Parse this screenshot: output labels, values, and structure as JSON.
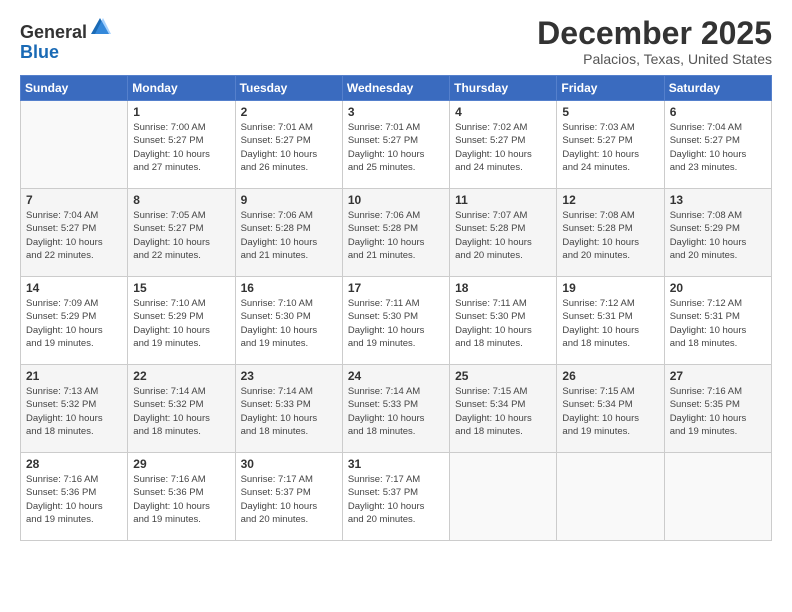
{
  "logo": {
    "general": "General",
    "blue": "Blue"
  },
  "header": {
    "month": "December 2025",
    "location": "Palacios, Texas, United States"
  },
  "days_of_week": [
    "Sunday",
    "Monday",
    "Tuesday",
    "Wednesday",
    "Thursday",
    "Friday",
    "Saturday"
  ],
  "weeks": [
    [
      {
        "num": "",
        "info": ""
      },
      {
        "num": "1",
        "info": "Sunrise: 7:00 AM\nSunset: 5:27 PM\nDaylight: 10 hours\nand 27 minutes."
      },
      {
        "num": "2",
        "info": "Sunrise: 7:01 AM\nSunset: 5:27 PM\nDaylight: 10 hours\nand 26 minutes."
      },
      {
        "num": "3",
        "info": "Sunrise: 7:01 AM\nSunset: 5:27 PM\nDaylight: 10 hours\nand 25 minutes."
      },
      {
        "num": "4",
        "info": "Sunrise: 7:02 AM\nSunset: 5:27 PM\nDaylight: 10 hours\nand 24 minutes."
      },
      {
        "num": "5",
        "info": "Sunrise: 7:03 AM\nSunset: 5:27 PM\nDaylight: 10 hours\nand 24 minutes."
      },
      {
        "num": "6",
        "info": "Sunrise: 7:04 AM\nSunset: 5:27 PM\nDaylight: 10 hours\nand 23 minutes."
      }
    ],
    [
      {
        "num": "7",
        "info": "Sunrise: 7:04 AM\nSunset: 5:27 PM\nDaylight: 10 hours\nand 22 minutes."
      },
      {
        "num": "8",
        "info": "Sunrise: 7:05 AM\nSunset: 5:27 PM\nDaylight: 10 hours\nand 22 minutes."
      },
      {
        "num": "9",
        "info": "Sunrise: 7:06 AM\nSunset: 5:28 PM\nDaylight: 10 hours\nand 21 minutes."
      },
      {
        "num": "10",
        "info": "Sunrise: 7:06 AM\nSunset: 5:28 PM\nDaylight: 10 hours\nand 21 minutes."
      },
      {
        "num": "11",
        "info": "Sunrise: 7:07 AM\nSunset: 5:28 PM\nDaylight: 10 hours\nand 20 minutes."
      },
      {
        "num": "12",
        "info": "Sunrise: 7:08 AM\nSunset: 5:28 PM\nDaylight: 10 hours\nand 20 minutes."
      },
      {
        "num": "13",
        "info": "Sunrise: 7:08 AM\nSunset: 5:29 PM\nDaylight: 10 hours\nand 20 minutes."
      }
    ],
    [
      {
        "num": "14",
        "info": "Sunrise: 7:09 AM\nSunset: 5:29 PM\nDaylight: 10 hours\nand 19 minutes."
      },
      {
        "num": "15",
        "info": "Sunrise: 7:10 AM\nSunset: 5:29 PM\nDaylight: 10 hours\nand 19 minutes."
      },
      {
        "num": "16",
        "info": "Sunrise: 7:10 AM\nSunset: 5:30 PM\nDaylight: 10 hours\nand 19 minutes."
      },
      {
        "num": "17",
        "info": "Sunrise: 7:11 AM\nSunset: 5:30 PM\nDaylight: 10 hours\nand 19 minutes."
      },
      {
        "num": "18",
        "info": "Sunrise: 7:11 AM\nSunset: 5:30 PM\nDaylight: 10 hours\nand 18 minutes."
      },
      {
        "num": "19",
        "info": "Sunrise: 7:12 AM\nSunset: 5:31 PM\nDaylight: 10 hours\nand 18 minutes."
      },
      {
        "num": "20",
        "info": "Sunrise: 7:12 AM\nSunset: 5:31 PM\nDaylight: 10 hours\nand 18 minutes."
      }
    ],
    [
      {
        "num": "21",
        "info": "Sunrise: 7:13 AM\nSunset: 5:32 PM\nDaylight: 10 hours\nand 18 minutes."
      },
      {
        "num": "22",
        "info": "Sunrise: 7:14 AM\nSunset: 5:32 PM\nDaylight: 10 hours\nand 18 minutes."
      },
      {
        "num": "23",
        "info": "Sunrise: 7:14 AM\nSunset: 5:33 PM\nDaylight: 10 hours\nand 18 minutes."
      },
      {
        "num": "24",
        "info": "Sunrise: 7:14 AM\nSunset: 5:33 PM\nDaylight: 10 hours\nand 18 minutes."
      },
      {
        "num": "25",
        "info": "Sunrise: 7:15 AM\nSunset: 5:34 PM\nDaylight: 10 hours\nand 18 minutes."
      },
      {
        "num": "26",
        "info": "Sunrise: 7:15 AM\nSunset: 5:34 PM\nDaylight: 10 hours\nand 19 minutes."
      },
      {
        "num": "27",
        "info": "Sunrise: 7:16 AM\nSunset: 5:35 PM\nDaylight: 10 hours\nand 19 minutes."
      }
    ],
    [
      {
        "num": "28",
        "info": "Sunrise: 7:16 AM\nSunset: 5:36 PM\nDaylight: 10 hours\nand 19 minutes."
      },
      {
        "num": "29",
        "info": "Sunrise: 7:16 AM\nSunset: 5:36 PM\nDaylight: 10 hours\nand 19 minutes."
      },
      {
        "num": "30",
        "info": "Sunrise: 7:17 AM\nSunset: 5:37 PM\nDaylight: 10 hours\nand 20 minutes."
      },
      {
        "num": "31",
        "info": "Sunrise: 7:17 AM\nSunset: 5:37 PM\nDaylight: 10 hours\nand 20 minutes."
      },
      {
        "num": "",
        "info": ""
      },
      {
        "num": "",
        "info": ""
      },
      {
        "num": "",
        "info": ""
      }
    ]
  ]
}
